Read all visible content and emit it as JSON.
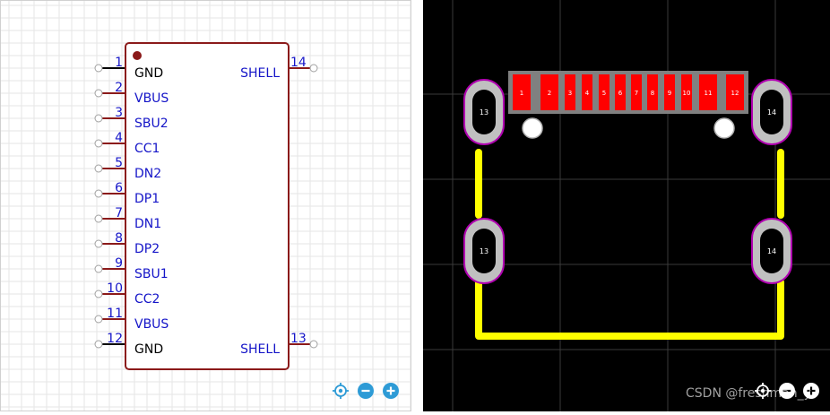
{
  "schematic": {
    "left_pins": [
      {
        "num": "1",
        "name": "GND",
        "kind": "ground"
      },
      {
        "num": "2",
        "name": "VBUS",
        "kind": "signal"
      },
      {
        "num": "3",
        "name": "SBU2",
        "kind": "signal"
      },
      {
        "num": "4",
        "name": "CC1",
        "kind": "signal"
      },
      {
        "num": "5",
        "name": "DN2",
        "kind": "signal"
      },
      {
        "num": "6",
        "name": "DP1",
        "kind": "signal"
      },
      {
        "num": "7",
        "name": "DN1",
        "kind": "signal"
      },
      {
        "num": "8",
        "name": "DP2",
        "kind": "signal"
      },
      {
        "num": "9",
        "name": "SBU1",
        "kind": "signal"
      },
      {
        "num": "10",
        "name": "CC2",
        "kind": "signal"
      },
      {
        "num": "11",
        "name": "VBUS",
        "kind": "signal"
      },
      {
        "num": "12",
        "name": "GND",
        "kind": "ground"
      }
    ],
    "right_pins": [
      {
        "num": "14",
        "name": "SHELL",
        "position": "top"
      },
      {
        "num": "13",
        "name": "SHELL",
        "position": "bottom"
      }
    ],
    "colors": {
      "body_outline": "#8b1a1a",
      "pin_line": "#8b1a1a",
      "ground_pin_line": "#000000",
      "pin_number": "#1515c8",
      "pin_name": "#1515c8",
      "ground_name": "#000000",
      "grid": "#e6e6e6",
      "background": "#ffffff"
    },
    "controls": {
      "locate_icon": "crosshair-icon",
      "zoom_out_icon": "minus-circle-icon",
      "zoom_in_icon": "plus-circle-icon",
      "accent": "#2e9bd6"
    }
  },
  "pcb": {
    "smd_pads": [
      "1",
      "2",
      "3",
      "4",
      "5",
      "6",
      "7",
      "8",
      "9",
      "10",
      "11",
      "12"
    ],
    "mount_pads": [
      {
        "label": "13",
        "position": "top-left"
      },
      {
        "label": "14",
        "position": "top-right"
      },
      {
        "label": "13",
        "position": "bottom-left"
      },
      {
        "label": "14",
        "position": "bottom-right"
      }
    ],
    "colors": {
      "background": "#000000",
      "grid": "#3a3a3a",
      "smd_pad": "#ff0000",
      "pad_label": "#ffffff",
      "pad_frame": "#808080",
      "silkscreen": "#ffff00",
      "through_hole_outline": "#b000b0",
      "through_hole_ring": "#c0c0c0",
      "drill": "#000000",
      "hole": "#ffffff"
    },
    "controls": {
      "locate_icon": "crosshair-icon",
      "zoom_out_icon": "minus-circle-icon",
      "zoom_in_icon": "plus-circle-icon",
      "accent": "#ffffff"
    }
  },
  "watermark": "CSDN @freshman_y"
}
